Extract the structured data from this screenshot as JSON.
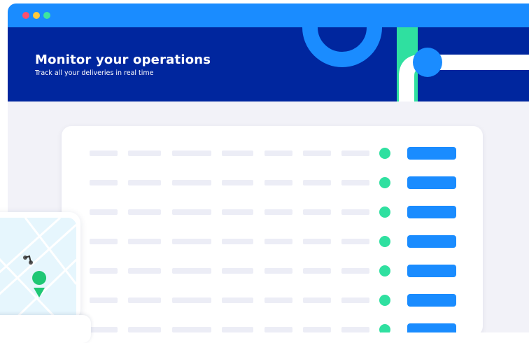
{
  "banner": {
    "title": "Monitor your operations",
    "subtitle": "Track all your deliveries in real time"
  },
  "colors": {
    "titlebar": "#1a8cff",
    "banner": "#00269e",
    "accent_green": "#2fe0a0",
    "button_blue": "#1a8cff",
    "placeholder": "#ecedf6"
  },
  "table": {
    "rows": 7,
    "columns_per_row": 7
  },
  "icons": [
    "close-dot",
    "minimize-dot",
    "maximize-dot",
    "location-pin-icon",
    "scooter-icon",
    "status-dot-icon"
  ]
}
